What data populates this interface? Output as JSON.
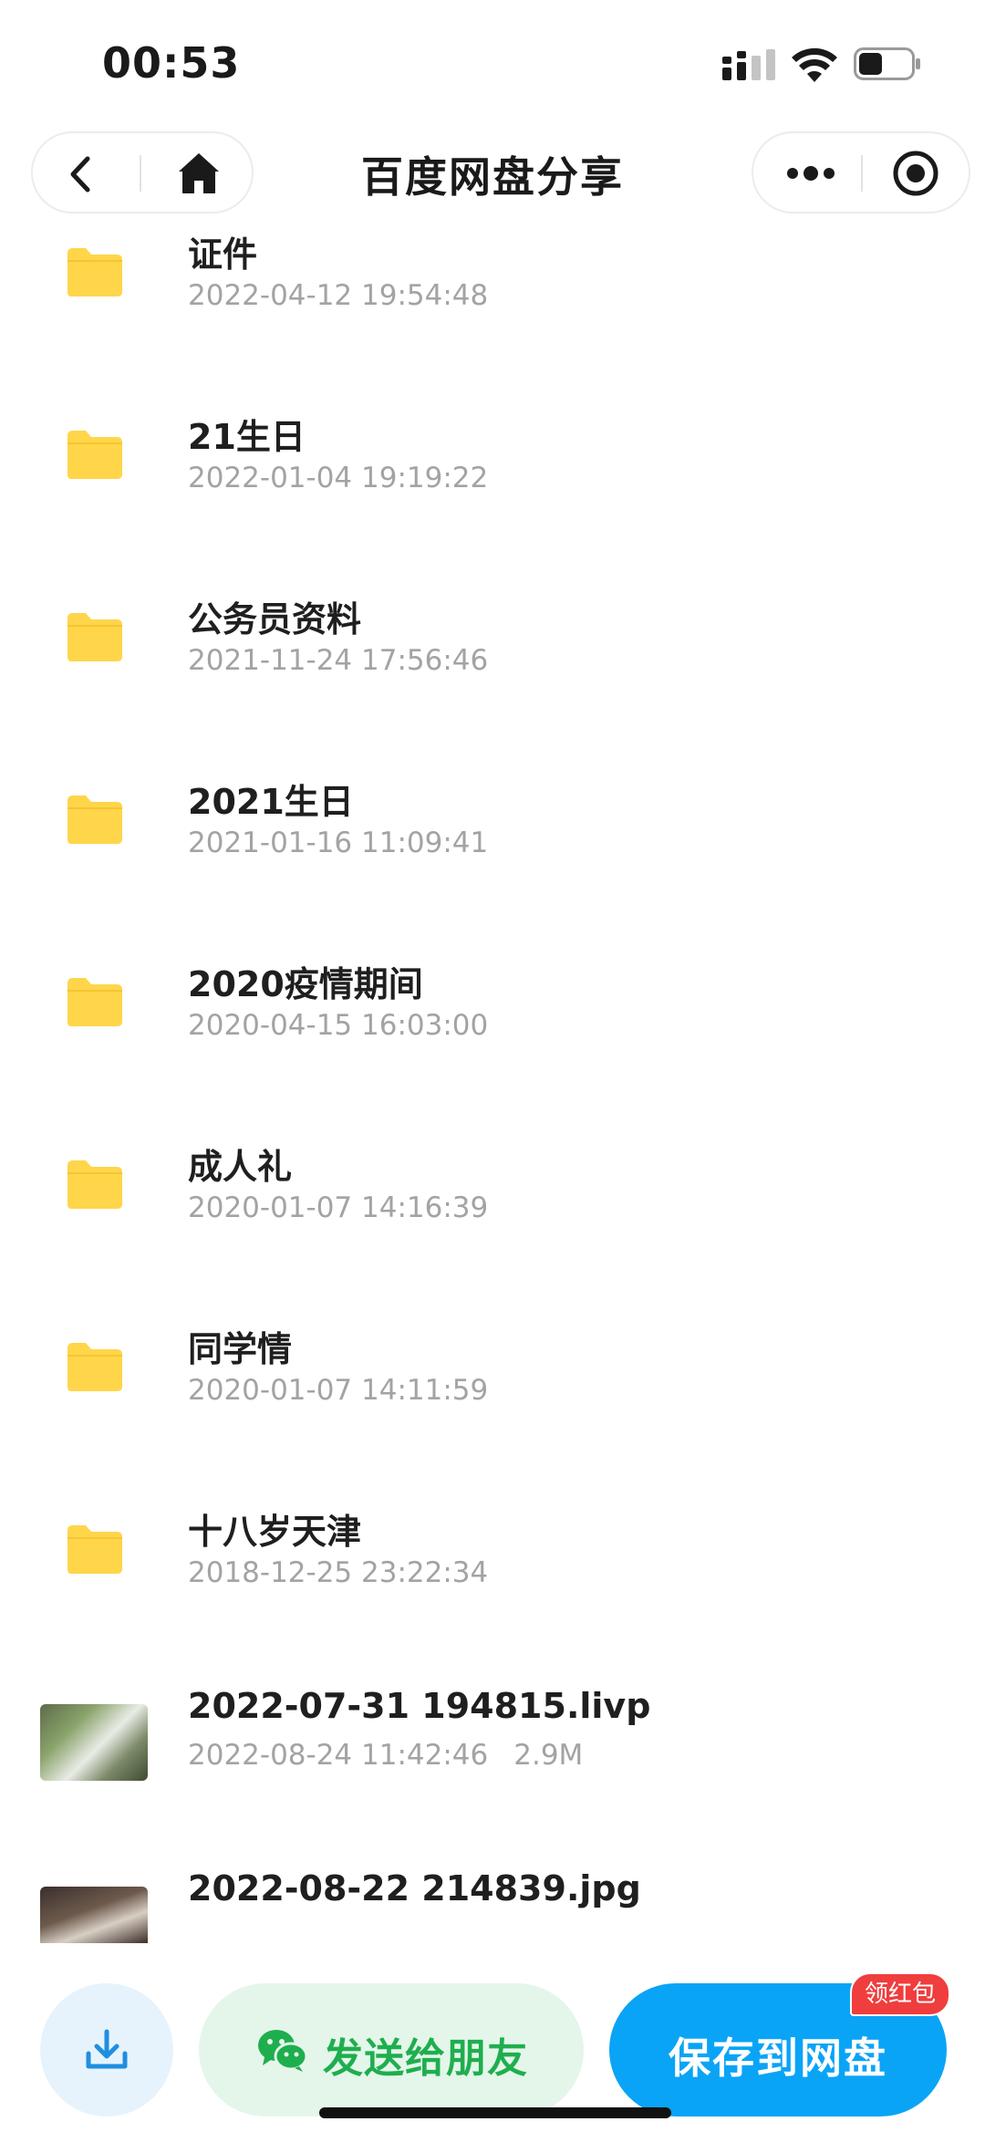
{
  "status_bar": {
    "time": "00:53",
    "battery_level": 0.45
  },
  "nav": {
    "title": "百度网盘分享"
  },
  "colors": {
    "folder": "#FFD54A",
    "accent": "#0AA4F6",
    "wechat_green": "#1FAE4E",
    "badge_red": "#F03D3D",
    "meta_gray": "#A3A3A3"
  },
  "icons": {
    "back": "chevron-left-icon",
    "home": "home-icon",
    "more": "more-dots-icon",
    "close": "target-circle-icon",
    "folder": "folder-icon",
    "download": "download-icon",
    "wechat": "wechat-icon"
  },
  "files": [
    {
      "type": "folder",
      "name": "证件",
      "date": "2022-04-12 19:54:48"
    },
    {
      "type": "folder",
      "name": "21生日",
      "date": "2022-01-04 19:19:22"
    },
    {
      "type": "folder",
      "name": "公务员资料",
      "date": "2021-11-24 17:56:46"
    },
    {
      "type": "folder",
      "name": "2021生日",
      "date": "2021-01-16 11:09:41"
    },
    {
      "type": "folder",
      "name": "2020疫情期间",
      "date": "2020-04-15 16:03:00"
    },
    {
      "type": "folder",
      "name": "成人礼",
      "date": "2020-01-07 14:16:39"
    },
    {
      "type": "folder",
      "name": "同学情",
      "date": "2020-01-07 14:11:59"
    },
    {
      "type": "folder",
      "name": "十八岁天津",
      "date": "2018-12-25 23:22:34"
    },
    {
      "type": "image",
      "name": "2022-07-31 194815.livp",
      "date": "2022-08-24 11:42:46",
      "size": "2.9M"
    },
    {
      "type": "image",
      "name": "2022-08-22 214839.jpg",
      "date": "",
      "size": ""
    }
  ],
  "bottom": {
    "share_label": "发送给朋友",
    "save_label": "保存到网盘",
    "badge": "领红包"
  }
}
